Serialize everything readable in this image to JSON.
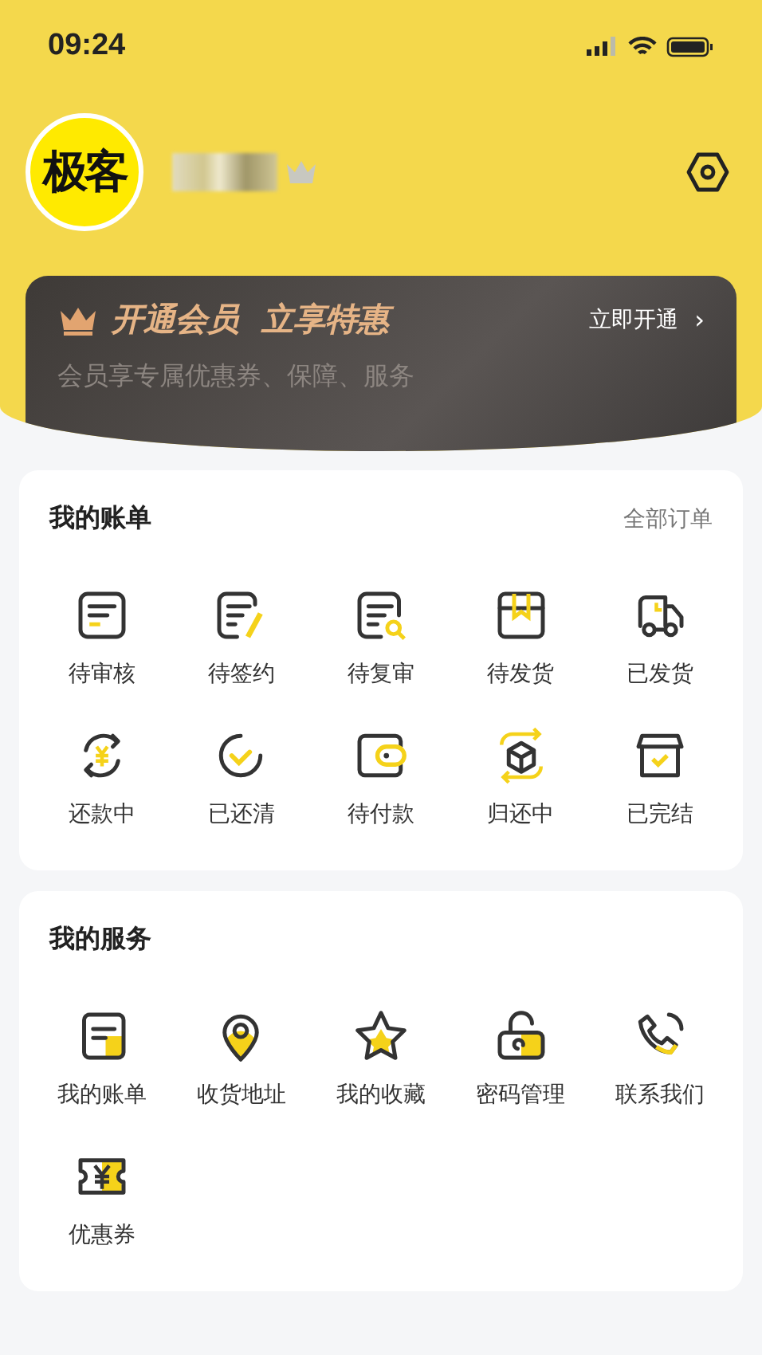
{
  "status_bar": {
    "time": "09:24"
  },
  "profile": {
    "logo_text": "极客"
  },
  "vip_banner": {
    "title": "开通会员  立享特惠",
    "subtitle": "会员享专属优惠券、保障、服务",
    "action": "立即开通",
    "action_arrow": "›"
  },
  "bills": {
    "title": "我的账单",
    "link": "全部订单",
    "items": [
      {
        "label": "待审核"
      },
      {
        "label": "待签约"
      },
      {
        "label": "待复审"
      },
      {
        "label": "待发货"
      },
      {
        "label": "已发货"
      },
      {
        "label": "还款中"
      },
      {
        "label": "已还清"
      },
      {
        "label": "待付款"
      },
      {
        "label": "归还中"
      },
      {
        "label": "已完结"
      }
    ]
  },
  "services": {
    "title": "我的服务",
    "items": [
      {
        "label": "我的账单"
      },
      {
        "label": "收货地址"
      },
      {
        "label": "我的收藏"
      },
      {
        "label": "密码管理"
      },
      {
        "label": "联系我们"
      },
      {
        "label": "优惠券"
      }
    ]
  }
}
